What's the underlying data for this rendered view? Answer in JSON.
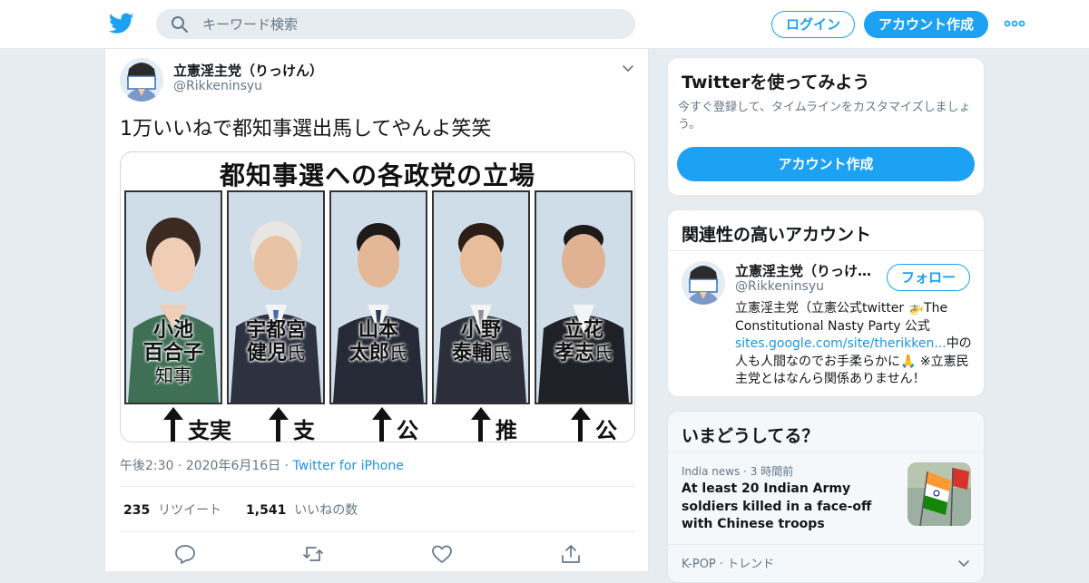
{
  "header": {
    "search_placeholder": "キーワード検索",
    "login_label": "ログイン",
    "signup_label": "アカウント作成",
    "brand_color": "#1da1f2"
  },
  "tweet": {
    "display_name": "立憲淫主党（りっけん）",
    "handle": "@Rikkeninsyu",
    "avatar_text": "立憲淫主党",
    "text": "1万いいねで都知事選出馬してやんよ笑笑",
    "image": {
      "title": "都知事選への各政党の立場",
      "panels": [
        {
          "line1": "小池",
          "line2": "百合子",
          "line3": "知事",
          "support": "支実"
        },
        {
          "line1": "宇都宮",
          "line2": "健児",
          "suffix": "氏",
          "support": "支"
        },
        {
          "line1": "山本",
          "line2": "太郎",
          "suffix": "氏",
          "support": "公"
        },
        {
          "line1": "小野",
          "line2": "泰輔",
          "suffix": "氏",
          "support": "推"
        },
        {
          "line1": "立花",
          "line2": "孝志",
          "suffix": "氏",
          "support": "公"
        }
      ]
    },
    "time": "午後2:30",
    "date": "2020年6月16日",
    "source": "Twitter for iPhone",
    "retweets_count": "235",
    "retweets_label": "リツイート",
    "likes_count": "1,541",
    "likes_label": "いいねの数"
  },
  "sidebar": {
    "signup_card": {
      "title": "Twitterを使ってみよう",
      "subtitle": "今すぐ登録して、タイムラインをカスタマイズしましょう。",
      "button": "アカウント作成"
    },
    "related": {
      "title": "関連性の高いアカウント",
      "name": "立憲淫主党（りっけん）",
      "handle": "@Rikkeninsyu",
      "follow": "フォロー",
      "bio_pre": "立憲淫主党（立憲公式twitter 🚁The Constitutional Nasty Party 公式",
      "bio_link": "sites.google.com/site/therikken...",
      "bio_post": "中の人も人間なのでお手柔らかに🙏 ※立憲民主党とはなんら関係ありません！"
    },
    "trends": {
      "title": "いまどうしてる？",
      "item1_source": "India news",
      "item1_time": "3 時間前",
      "item1_title": "At least 20 Indian Army soldiers killed in a face-off with Chinese troops",
      "item2_label": "K-POP · トレンド"
    }
  }
}
